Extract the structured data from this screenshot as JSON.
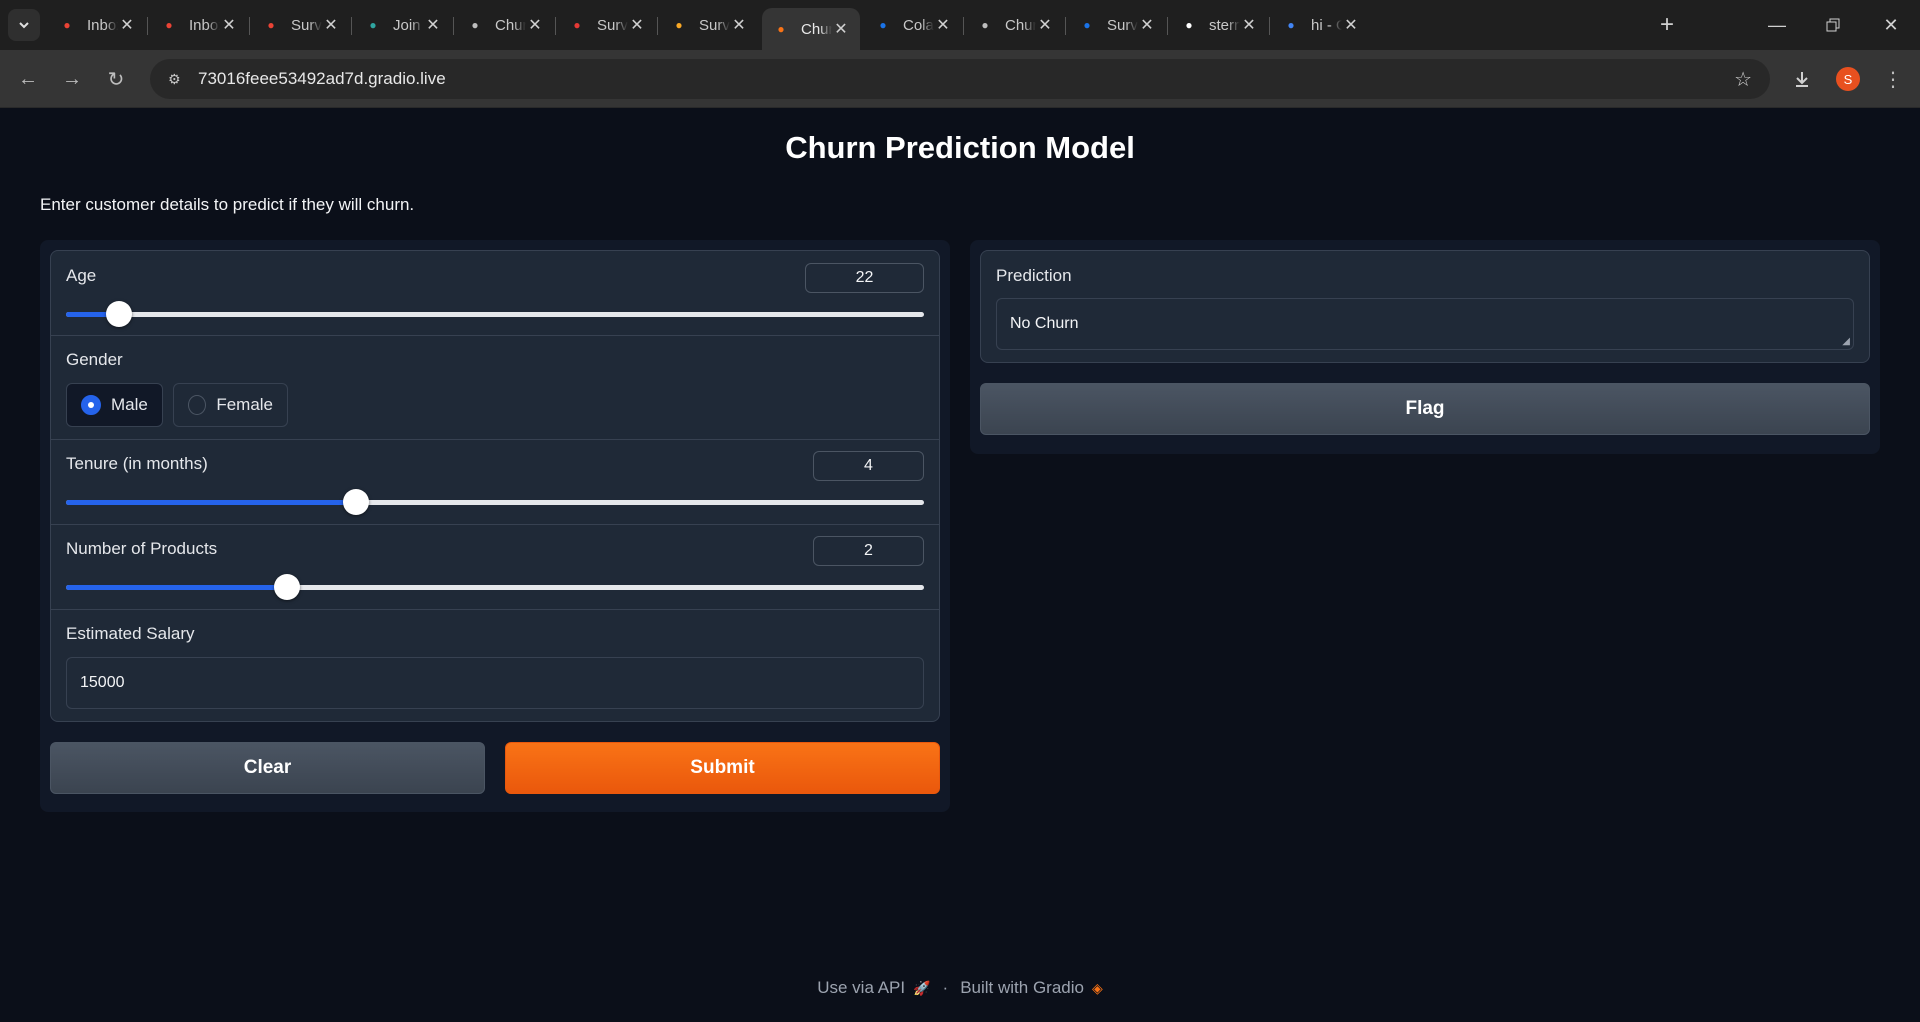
{
  "browser": {
    "tabs": [
      {
        "title": "Inbox",
        "favicon": "gmail-icon",
        "color": "#ea4335",
        "active": false
      },
      {
        "title": "Inbox",
        "favicon": "gmail-icon",
        "color": "#ea4335",
        "active": false
      },
      {
        "title": "Survey",
        "favicon": "gmail-icon",
        "color": "#ea4335",
        "active": false
      },
      {
        "title": "Join",
        "favicon": "join-icon",
        "color": "#2fa5a0",
        "active": false
      },
      {
        "title": "Churn",
        "favicon": "globe-icon",
        "color": "#bdbdbd",
        "active": false
      },
      {
        "title": "Survey",
        "favicon": "infinity-icon",
        "color": "#e53935",
        "active": false
      },
      {
        "title": "Survey",
        "favicon": "infinity-icon",
        "color": "#f9a825",
        "active": false
      },
      {
        "title": "Churn",
        "favicon": "gradio-icon",
        "color": "#f97316",
        "active": true
      },
      {
        "title": "Colab",
        "favicon": "drive-icon",
        "color": "#1a73e8",
        "active": false
      },
      {
        "title": "Churn",
        "favicon": "globe-icon",
        "color": "#bdbdbd",
        "active": false
      },
      {
        "title": "Survey",
        "favicon": "drive-icon",
        "color": "#1a73e8",
        "active": false
      },
      {
        "title": "sterry",
        "favicon": "github-icon",
        "color": "#ffffff",
        "active": false
      },
      {
        "title": "hi - G",
        "favicon": "google-icon",
        "color": "#4285f4",
        "active": false
      }
    ],
    "url": "73016feee53492ad7d.gradio.live",
    "profile_initial": "S"
  },
  "app": {
    "title": "Churn Prediction Model",
    "description": "Enter customer details to predict if they will churn.",
    "inputs": {
      "age": {
        "label": "Age",
        "value": "22",
        "level": 0.062
      },
      "gender": {
        "label": "Gender",
        "options": [
          "Male",
          "Female"
        ],
        "selected": "Male"
      },
      "tenure": {
        "label": "Tenure (in months)",
        "value": "4",
        "level": 0.338
      },
      "products": {
        "label": "Number of Products",
        "value": "2",
        "level": 0.257
      },
      "salary": {
        "label": "Estimated Salary",
        "value": "15000"
      }
    },
    "buttons": {
      "clear": "Clear",
      "submit": "Submit",
      "flag": "Flag"
    },
    "output": {
      "label": "Prediction",
      "value": "No Churn"
    },
    "footer": {
      "api": "Use via API",
      "separator": "·",
      "built": "Built with Gradio"
    },
    "colors": {
      "primary": "#f97316",
      "slider": "#2563eb",
      "background": "#0b0f19"
    }
  }
}
